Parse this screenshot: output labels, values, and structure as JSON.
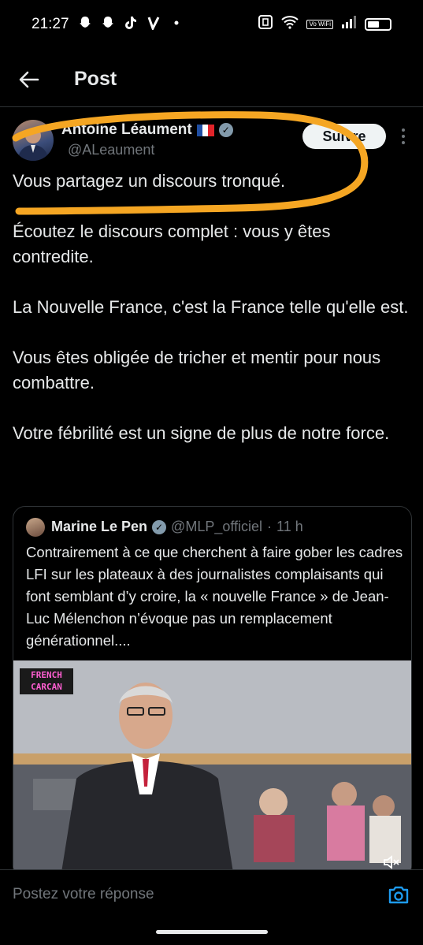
{
  "status_bar": {
    "time": "21:27",
    "left_icons": [
      "snapchat-icon",
      "snapchat-icon",
      "tiktok-icon",
      "v-app-icon",
      "dot-icon"
    ],
    "vowifi": "Vo WiFi",
    "battery_level": 0.55
  },
  "header": {
    "title": "Post"
  },
  "author": {
    "name": "Antoine Léaument",
    "handle": "@ALeaument",
    "follow_label": "Suivre"
  },
  "post": {
    "paragraphs": [
      "Vous partagez un discours tronqué.",
      "Écoutez le discours complet : vous y êtes contredite.",
      "La Nouvelle France, c'est la France telle qu'elle est.",
      "Vous êtes obligée de tricher et mentir pour nous combattre.",
      "Votre fébrilité est un signe de plus de notre force."
    ]
  },
  "quote": {
    "name": "Marine Le Pen",
    "handle": "@MLP_officiel",
    "separator": "·",
    "time": "11 h",
    "text": "Contrairement à ce que cherchent à faire gober les cadres LFI sur les plateaux à des journalistes complaisants qui font semblant d’y croire, la « nouvelle France » de Jean-Luc Mélenchon n’évoque pas un remplacement générationnel....",
    "media_badge_line1": "FRENCH",
    "media_badge_line2": "CARCAN"
  },
  "reply": {
    "placeholder": "Postez votre réponse"
  },
  "colors": {
    "background": "#000000",
    "text": "#e7e9ea",
    "muted": "#71767b",
    "divider": "#2f3336",
    "accent": "#1d9bf0",
    "annotation": "#f5a623"
  }
}
